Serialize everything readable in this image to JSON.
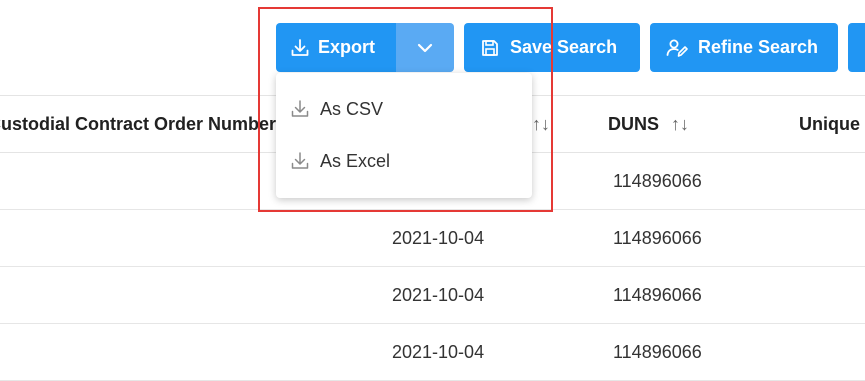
{
  "toolbar": {
    "export_label": "Export",
    "save_search_label": "Save Search",
    "refine_search_label": "Refine Search"
  },
  "export_menu": {
    "items": [
      {
        "label": "As CSV"
      },
      {
        "label": "As Excel"
      }
    ]
  },
  "table": {
    "headers": {
      "custodial": "Custodial Contract Order Number",
      "duns": "DUNS",
      "unique": "Unique"
    },
    "sort_glyph": "↑↓",
    "rows": [
      {
        "date": "",
        "duns": "114896066"
      },
      {
        "date": "2021-10-04",
        "duns": "114896066"
      },
      {
        "date": "2021-10-04",
        "duns": "114896066"
      },
      {
        "date": "2021-10-04",
        "duns": "114896066"
      }
    ]
  },
  "colors": {
    "primary": "#2196f3",
    "caret_bg": "#5aaaf3",
    "highlight": "#e53935"
  }
}
